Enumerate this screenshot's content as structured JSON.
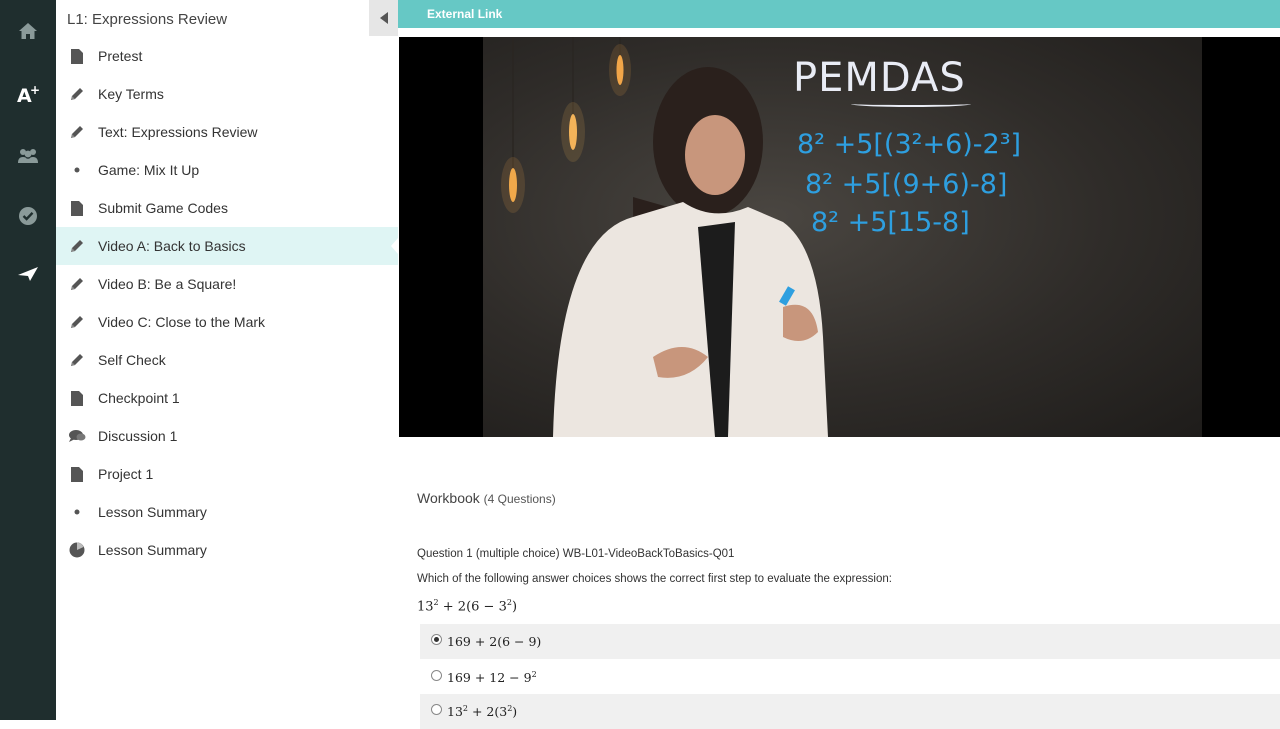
{
  "rail": {
    "icons": [
      "home-icon",
      "grades-icon",
      "people-icon",
      "checkmark-icon",
      "send-icon"
    ]
  },
  "sidebar": {
    "title": "L1: Expressions Review",
    "items": [
      {
        "label": "Pretest",
        "icon": "document-icon"
      },
      {
        "label": "Key Terms",
        "icon": "pencil-icon"
      },
      {
        "label": "Text: Expressions Review",
        "icon": "pencil-icon"
      },
      {
        "label": "Game: Mix It Up",
        "icon": "dot-icon"
      },
      {
        "label": "Submit Game Codes",
        "icon": "document-icon"
      },
      {
        "label": "Video A: Back to Basics",
        "icon": "pencil-icon",
        "active": true
      },
      {
        "label": "Video B: Be a Square!",
        "icon": "pencil-icon"
      },
      {
        "label": "Video C: Close to the Mark",
        "icon": "pencil-icon"
      },
      {
        "label": "Self Check",
        "icon": "pencil-icon"
      },
      {
        "label": "Checkpoint 1",
        "icon": "document-icon"
      },
      {
        "label": "Discussion 1",
        "icon": "discussion-icon"
      },
      {
        "label": "Project 1",
        "icon": "document-icon"
      },
      {
        "label": "Lesson Summary",
        "icon": "dot-icon"
      },
      {
        "label": "Lesson Summary",
        "icon": "pie-icon"
      }
    ]
  },
  "main": {
    "external_link": "External Link",
    "video": {
      "board_title": "PEMDAS",
      "board_lines": [
        "8² +5[(3²+6)-2³]",
        "8² +5[(9+6)-8]",
        "8² +5[15-8]"
      ]
    },
    "workbook": {
      "title": "Workbook",
      "count": "(4 Questions)",
      "question_meta": "Question 1 (multiple choice)  WB-L01-VideoBackToBasics-Q01",
      "question_prompt": "Which of the following answer choices shows the correct first step to evaluate the expression:",
      "choices_selected_index": 0
    }
  },
  "colors": {
    "rail": "#1f2e2e",
    "accent": "#66c8c5",
    "active_item": "#dff5f4",
    "marker": "#2e9fe0"
  }
}
